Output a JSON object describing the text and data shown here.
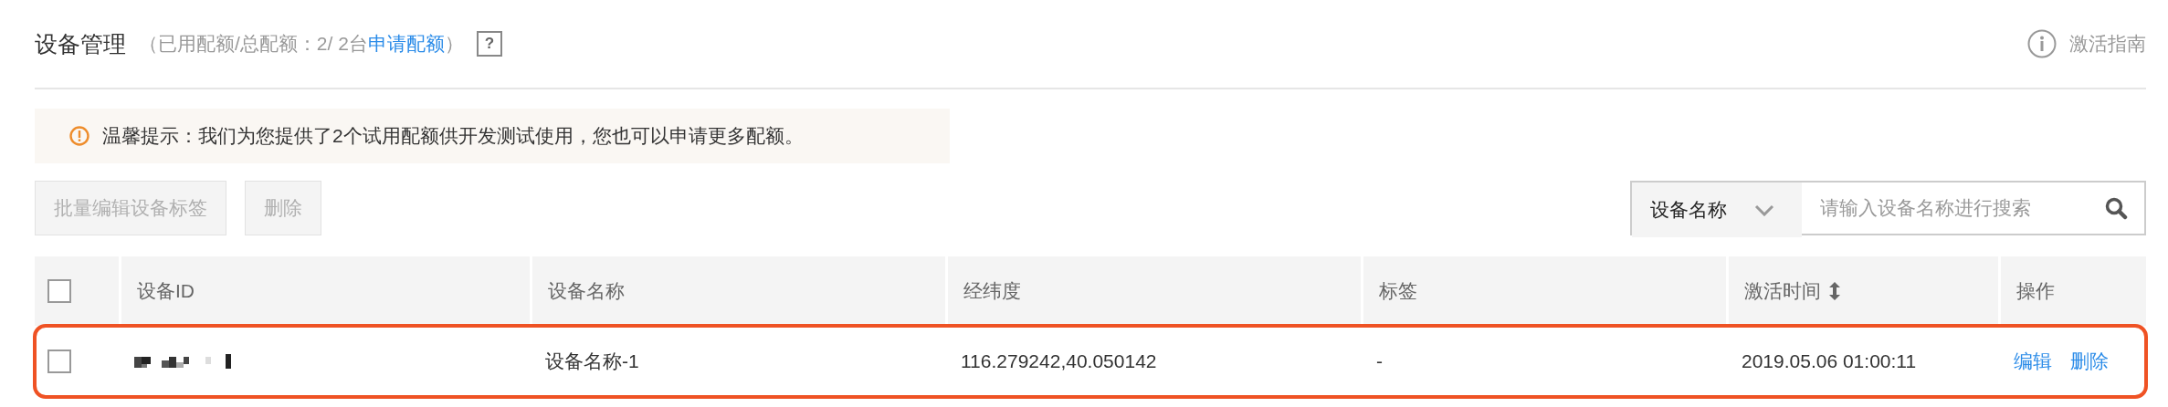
{
  "header": {
    "title": "设备管理",
    "quota_text": "（已用配额/总配额：2/ 2台",
    "quota_link": "申请配额",
    "quota_close": "）",
    "help": "?",
    "guide": "激活指南"
  },
  "tip": {
    "text": "温馨提示：我们为您提供了2个试用配额供开发测试使用，您也可以申请更多配额。"
  },
  "toolbar": {
    "buttons": [
      {
        "label": "批量编辑设备标签",
        "disabled": true
      },
      {
        "label": "删除",
        "disabled": true
      }
    ],
    "search": {
      "field": "设备名称",
      "placeholder": "请输入设备名称进行搜索"
    }
  },
  "table": {
    "select_all": {
      "checked": false
    },
    "columns": [
      {
        "label": "设备ID",
        "sortable": false
      },
      {
        "label": "设备名称",
        "sortable": false
      },
      {
        "label": "经纬度",
        "sortable": false
      },
      {
        "label": "标签",
        "sortable": false
      },
      {
        "label": "激活时间",
        "sortable": true
      },
      {
        "label": "操作",
        "sortable": false
      }
    ],
    "rows": [
      {
        "checked": false,
        "highlighted": true,
        "device_id": {
          "kind": "picture"
        },
        "cells": [
          "",
          "设备名称-1",
          "116.279242,40.050142",
          "-",
          "2019.05.06 01:00:11"
        ],
        "actions": [
          "编辑",
          "删除"
        ]
      }
    ]
  }
}
